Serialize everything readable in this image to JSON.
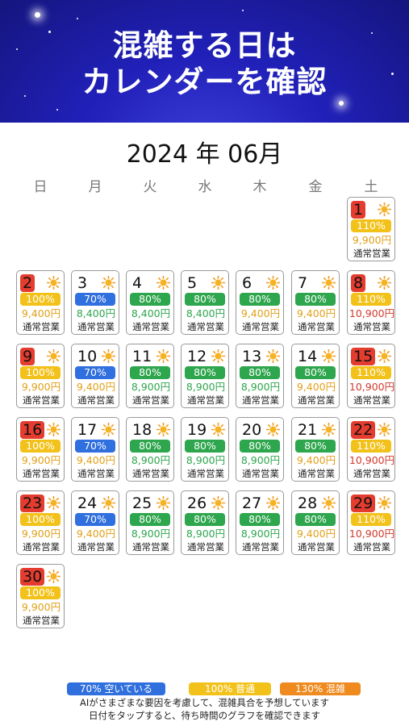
{
  "banner": {
    "line1": "混雑する日は",
    "line2": "カレンダーを確認"
  },
  "calendar": {
    "month_title": "2024 年 06月",
    "weekdays": [
      "日",
      "月",
      "火",
      "水",
      "木",
      "金",
      "土"
    ],
    "leading_blank_days": 6,
    "days": [
      {
        "day": "1",
        "pct": "110%",
        "pct_color": "yellow",
        "price": "9,900円",
        "price_color": "orange",
        "status": "通常営業",
        "highlight": true
      },
      {
        "day": "2",
        "pct": "100%",
        "pct_color": "yellow",
        "price": "9,400円",
        "price_color": "orange",
        "status": "通常営業",
        "highlight": true
      },
      {
        "day": "3",
        "pct": "70%",
        "pct_color": "blue",
        "price": "8,400円",
        "price_color": "green",
        "status": "通常営業",
        "highlight": false
      },
      {
        "day": "4",
        "pct": "80%",
        "pct_color": "green",
        "price": "8,400円",
        "price_color": "green",
        "status": "通常営業",
        "highlight": false
      },
      {
        "day": "5",
        "pct": "80%",
        "pct_color": "green",
        "price": "8,400円",
        "price_color": "green",
        "status": "通常営業",
        "highlight": false
      },
      {
        "day": "6",
        "pct": "80%",
        "pct_color": "green",
        "price": "9,400円",
        "price_color": "orange",
        "status": "通常営業",
        "highlight": false
      },
      {
        "day": "7",
        "pct": "80%",
        "pct_color": "green",
        "price": "9,400円",
        "price_color": "orange",
        "status": "通常営業",
        "highlight": false
      },
      {
        "day": "8",
        "pct": "110%",
        "pct_color": "yellow",
        "price": "10,900円",
        "price_color": "red",
        "status": "通常営業",
        "highlight": true
      },
      {
        "day": "9",
        "pct": "100%",
        "pct_color": "yellow",
        "price": "9,900円",
        "price_color": "orange",
        "status": "通常営業",
        "highlight": true
      },
      {
        "day": "10",
        "pct": "70%",
        "pct_color": "blue",
        "price": "9,400円",
        "price_color": "orange",
        "status": "通常営業",
        "highlight": false
      },
      {
        "day": "11",
        "pct": "80%",
        "pct_color": "green",
        "price": "8,900円",
        "price_color": "green",
        "status": "通常営業",
        "highlight": false
      },
      {
        "day": "12",
        "pct": "80%",
        "pct_color": "green",
        "price": "8,900円",
        "price_color": "green",
        "status": "通常営業",
        "highlight": false
      },
      {
        "day": "13",
        "pct": "80%",
        "pct_color": "green",
        "price": "8,900円",
        "price_color": "green",
        "status": "通常営業",
        "highlight": false
      },
      {
        "day": "14",
        "pct": "80%",
        "pct_color": "green",
        "price": "9,400円",
        "price_color": "orange",
        "status": "通常営業",
        "highlight": false
      },
      {
        "day": "15",
        "pct": "110%",
        "pct_color": "yellow",
        "price": "10,900円",
        "price_color": "red",
        "status": "通常営業",
        "highlight": true
      },
      {
        "day": "16",
        "pct": "100%",
        "pct_color": "yellow",
        "price": "9,900円",
        "price_color": "orange",
        "status": "通常営業",
        "highlight": true
      },
      {
        "day": "17",
        "pct": "70%",
        "pct_color": "blue",
        "price": "9,400円",
        "price_color": "orange",
        "status": "通常営業",
        "highlight": false
      },
      {
        "day": "18",
        "pct": "80%",
        "pct_color": "green",
        "price": "8,900円",
        "price_color": "green",
        "status": "通常営業",
        "highlight": false
      },
      {
        "day": "19",
        "pct": "80%",
        "pct_color": "green",
        "price": "8,900円",
        "price_color": "green",
        "status": "通常営業",
        "highlight": false
      },
      {
        "day": "20",
        "pct": "80%",
        "pct_color": "green",
        "price": "8,900円",
        "price_color": "green",
        "status": "通常営業",
        "highlight": false
      },
      {
        "day": "21",
        "pct": "80%",
        "pct_color": "green",
        "price": "9,400円",
        "price_color": "orange",
        "status": "通常営業",
        "highlight": false
      },
      {
        "day": "22",
        "pct": "110%",
        "pct_color": "yellow",
        "price": "10,900円",
        "price_color": "red",
        "status": "通常営業",
        "highlight": true
      },
      {
        "day": "23",
        "pct": "100%",
        "pct_color": "yellow",
        "price": "9,900円",
        "price_color": "orange",
        "status": "通常営業",
        "highlight": true
      },
      {
        "day": "24",
        "pct": "70%",
        "pct_color": "blue",
        "price": "9,400円",
        "price_color": "orange",
        "status": "通常営業",
        "highlight": false
      },
      {
        "day": "25",
        "pct": "80%",
        "pct_color": "green",
        "price": "8,900円",
        "price_color": "green",
        "status": "通常営業",
        "highlight": false
      },
      {
        "day": "26",
        "pct": "80%",
        "pct_color": "green",
        "price": "8,900円",
        "price_color": "green",
        "status": "通常営業",
        "highlight": false
      },
      {
        "day": "27",
        "pct": "80%",
        "pct_color": "green",
        "price": "8,900円",
        "price_color": "green",
        "status": "通常営業",
        "highlight": false
      },
      {
        "day": "28",
        "pct": "80%",
        "pct_color": "green",
        "price": "9,400円",
        "price_color": "orange",
        "status": "通常営業",
        "highlight": false
      },
      {
        "day": "29",
        "pct": "110%",
        "pct_color": "yellow",
        "price": "10,900円",
        "price_color": "red",
        "status": "通常営業",
        "highlight": true
      },
      {
        "day": "30",
        "pct": "100%",
        "pct_color": "yellow",
        "price": "9,900円",
        "price_color": "orange",
        "status": "通常営業",
        "highlight": true
      }
    ],
    "weather_icon": "sun-icon"
  },
  "legend": [
    {
      "label": "70% 空いている",
      "color": "#2f6fde"
    },
    {
      "label": "100% 普通",
      "color": "#f2c21b"
    },
    {
      "label": "130% 混雑",
      "color": "#ef8a1e"
    }
  ],
  "notes": {
    "line1": "AIがさまざまな要因を考慮して、混雑具合を予想しています",
    "line2": "日付をタップすると、待ち時間のグラフを確認できます"
  },
  "colors": {
    "banner_bg": "#2020b8",
    "highlight_red": "#e43d2f",
    "green": "#2ea64d",
    "yellow": "#f2c21b",
    "blue": "#2f6fde",
    "price_red": "#d23a2c",
    "price_orange": "#e1a019"
  }
}
